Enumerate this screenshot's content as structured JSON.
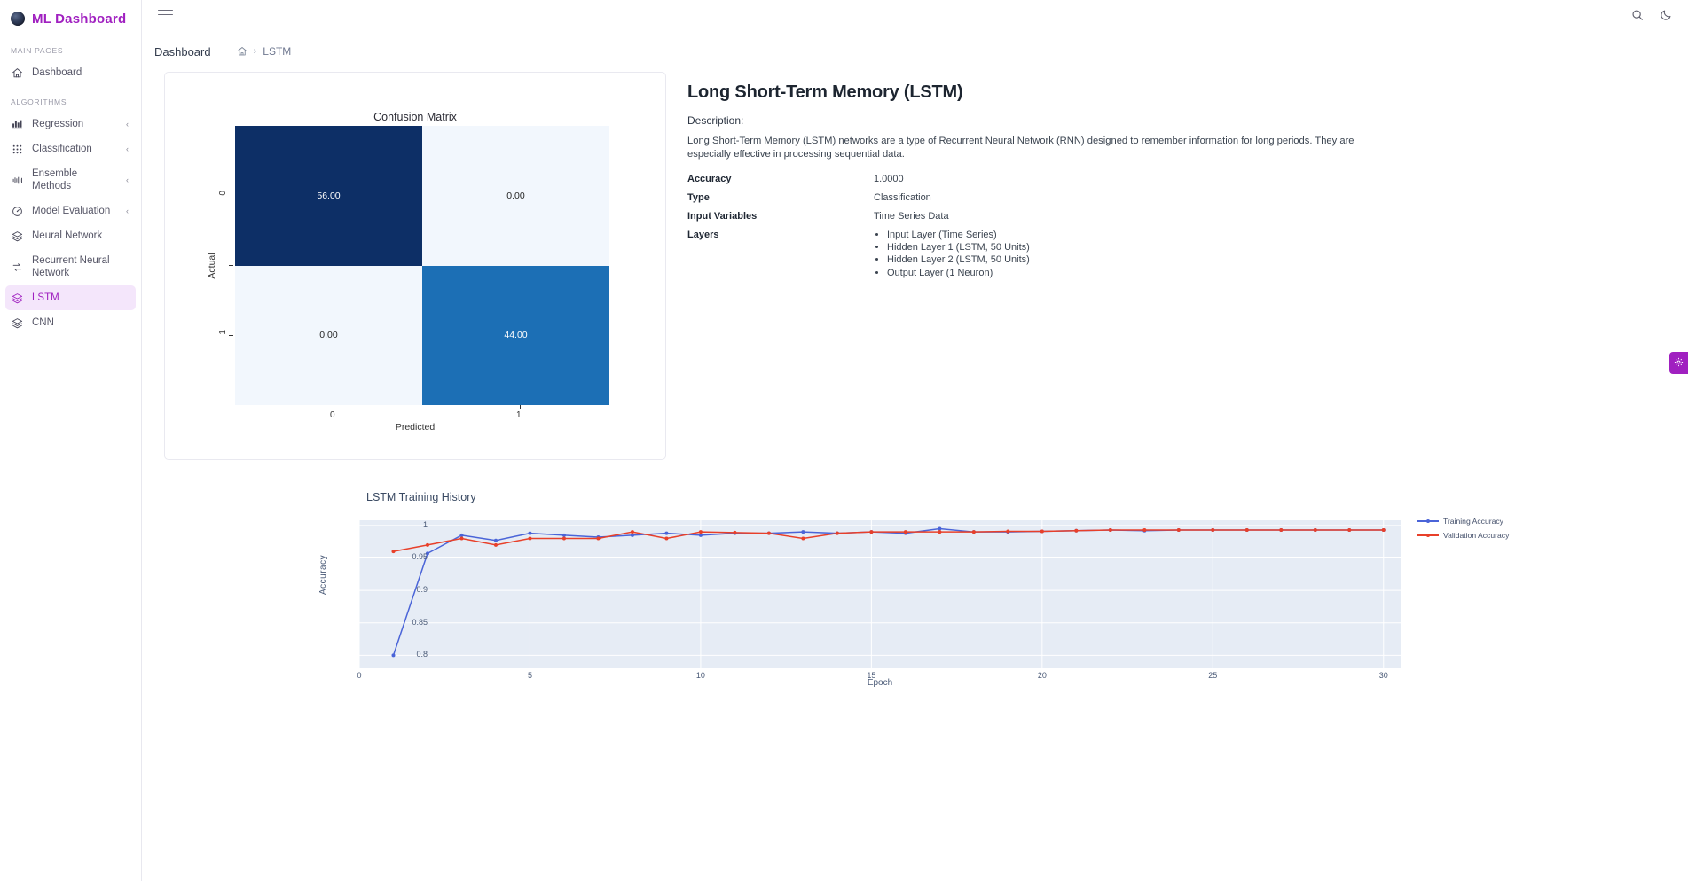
{
  "brand": {
    "name": "ML Dashboard",
    "logo_icon": "globe-icon"
  },
  "sidebar": {
    "sections": [
      {
        "label": "MAIN PAGES"
      },
      {
        "label": "ALGORITHMS"
      }
    ],
    "main_items": [
      {
        "label": "Dashboard",
        "icon": "home-icon",
        "active": false,
        "chevron": ""
      }
    ],
    "algorithm_items": [
      {
        "label": "Regression",
        "icon": "bar-chart-icon",
        "active": false,
        "chevron": "‹"
      },
      {
        "label": "Classification",
        "icon": "grid-dots-icon",
        "active": false,
        "chevron": "‹"
      },
      {
        "label": "Ensemble Methods",
        "icon": "waveform-icon",
        "active": false,
        "chevron": "‹"
      },
      {
        "label": "Model Evaluation",
        "icon": "gauge-icon",
        "active": false,
        "chevron": "‹"
      },
      {
        "label": "Neural Network",
        "icon": "layers-icon",
        "active": false,
        "chevron": ""
      },
      {
        "label": "Recurrent Neural Network",
        "icon": "loop-arrows-icon",
        "active": false,
        "chevron": ""
      },
      {
        "label": "LSTM",
        "icon": "layers-icon",
        "active": true,
        "chevron": ""
      },
      {
        "label": "CNN",
        "icon": "layers-icon",
        "active": false,
        "chevron": ""
      }
    ]
  },
  "topbar": {
    "menu_icon": "hamburger-icon",
    "search_icon": "search-icon",
    "theme_icon": "moon-icon"
  },
  "breadcrumb": {
    "root": "Dashboard",
    "home_icon": "home-icon",
    "separator": "›",
    "current": "LSTM"
  },
  "info": {
    "title": "Long Short-Term Memory (LSTM)",
    "description_label": "Description:",
    "description": "Long Short-Term Memory (LSTM) networks are a type of Recurrent Neural Network (RNN) designed to remember information for long periods. They are especially effective in processing sequential data.",
    "rows": [
      {
        "key": "Accuracy",
        "value": "1.0000"
      },
      {
        "key": "Type",
        "value": "Classification"
      },
      {
        "key": "Input Variables",
        "value": "Time Series Data"
      }
    ],
    "layers_key": "Layers",
    "layers": [
      "Input Layer (Time Series)",
      "Hidden Layer 1 (LSTM, 50 Units)",
      "Hidden Layer 2 (LSTM, 50 Units)",
      "Output Layer (1 Neuron)"
    ]
  },
  "float_tab": {
    "icon": "gear-icon",
    "color": "#a020c0"
  },
  "chart_data": [
    {
      "type": "heatmap",
      "title": "Confusion Matrix",
      "xlabel": "Predicted",
      "ylabel": "Actual",
      "x_ticks": [
        "0",
        "1"
      ],
      "y_ticks": [
        "0",
        "1"
      ],
      "matrix": [
        [
          56.0,
          0.0
        ],
        [
          0.0,
          44.0
        ]
      ],
      "cell_labels": [
        [
          "56.00",
          "0.00"
        ],
        [
          "0.00",
          "44.00"
        ]
      ],
      "cell_colors": [
        [
          "#0d2f66",
          "#f2f7fd"
        ],
        [
          "#f2f7fd",
          "#1c6fb5"
        ]
      ],
      "cell_text_colors": [
        [
          "#ffffff",
          "#262626"
        ],
        [
          "#262626",
          "#ffffff"
        ]
      ],
      "colorscale": "Blues",
      "zmin": 0,
      "zmax": 56
    },
    {
      "type": "line",
      "title": "LSTM Training History",
      "xlabel": "Epoch",
      "ylabel": "Accuracy",
      "xlim": [
        0,
        30.5
      ],
      "ylim": [
        0.78,
        1.008
      ],
      "x_ticks": [
        0,
        5,
        10,
        15,
        20,
        25,
        30
      ],
      "y_ticks": [
        0.8,
        0.85,
        0.9,
        0.95,
        1
      ],
      "y_tick_labels": [
        "0.8",
        "0.85",
        "0.9",
        "0.95",
        "1"
      ],
      "grid": true,
      "legend_position": "right",
      "plot_bgcolor": "#e6ecf5",
      "x": [
        1,
        2,
        3,
        4,
        5,
        6,
        7,
        8,
        9,
        10,
        11,
        12,
        13,
        14,
        15,
        16,
        17,
        18,
        19,
        20,
        21,
        22,
        23,
        24,
        25,
        26,
        27,
        28,
        29,
        30
      ],
      "series": [
        {
          "name": "Training Accuracy",
          "color": "#4a64d8",
          "values": [
            0.8,
            0.957,
            0.985,
            0.977,
            0.988,
            0.985,
            0.982,
            0.985,
            0.988,
            0.985,
            0.988,
            0.988,
            0.99,
            0.988,
            0.99,
            0.988,
            0.995,
            0.99,
            0.99,
            0.991,
            0.992,
            0.993,
            0.992,
            0.993,
            0.993,
            0.993,
            0.993,
            0.993,
            0.993,
            0.993
          ]
        },
        {
          "name": "Validation Accuracy",
          "color": "#e8402a",
          "values": [
            0.96,
            0.97,
            0.98,
            0.97,
            0.98,
            0.98,
            0.98,
            0.99,
            0.98,
            0.99,
            0.989,
            0.988,
            0.98,
            0.988,
            0.99,
            0.99,
            0.99,
            0.99,
            0.991,
            0.991,
            0.992,
            0.993,
            0.993,
            0.993,
            0.993,
            0.993,
            0.993,
            0.993,
            0.993,
            0.993
          ]
        }
      ]
    }
  ]
}
